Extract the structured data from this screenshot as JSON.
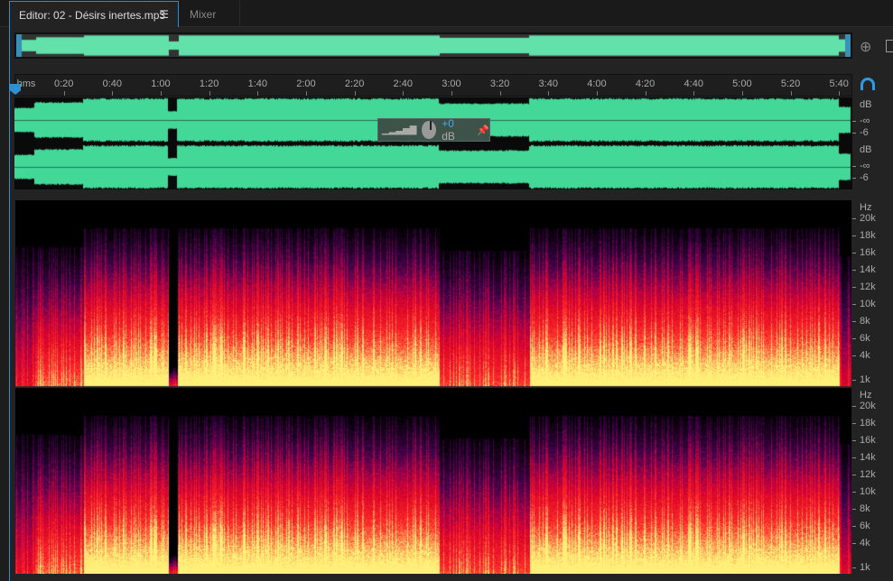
{
  "tabs": [
    {
      "label": "Editor: 02 - Désirs inertes.mp3",
      "active": true,
      "menu_icon": "hamburger-icon"
    },
    {
      "label": "Mixer",
      "active": false
    }
  ],
  "ruler": {
    "unit": "hms",
    "ticks": [
      "0:20",
      "0:40",
      "1:00",
      "1:20",
      "1:40",
      "2:00",
      "2:20",
      "2:40",
      "3:00",
      "3:20",
      "3:40",
      "4:00",
      "4:20",
      "4:40",
      "5:00",
      "5:20",
      "5:40"
    ]
  },
  "hud": {
    "gain": "+0",
    "unit": "dB"
  },
  "amp_scale": {
    "unit": "dB",
    "labels": [
      "-∞",
      "-6"
    ]
  },
  "freq_scale": {
    "unit": "Hz",
    "labels": [
      "20k",
      "18k",
      "16k",
      "14k",
      "12k",
      "10k",
      "8k",
      "6k",
      "4k",
      "1k"
    ]
  },
  "colors": {
    "waveform": "#44d898",
    "accent": "#2f8fd0"
  }
}
